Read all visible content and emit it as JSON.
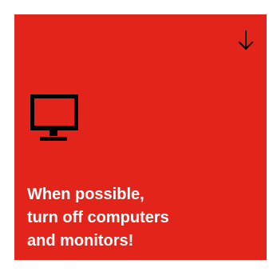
{
  "tile": {
    "background_color": "#E3241B",
    "text_color": "#FFFFFF",
    "message": "When possible,\nturn off computers\nand monitors!",
    "icons": {
      "top_right": "arrow-down-icon",
      "main": "monitor-icon"
    }
  }
}
